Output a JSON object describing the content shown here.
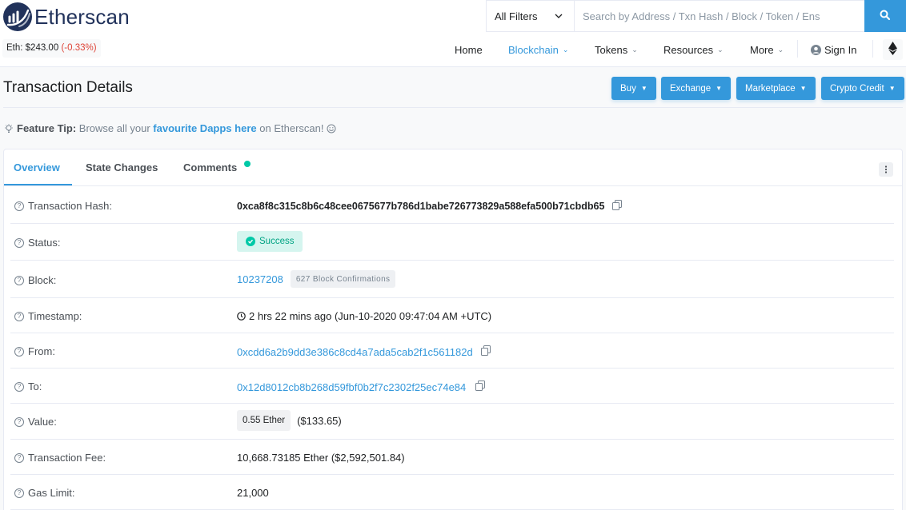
{
  "header": {
    "brand": "Etherscan",
    "eth_price_label": "Eth: $243.00",
    "eth_price_change": "(-0.33%)",
    "search": {
      "filter": "All Filters",
      "placeholder": "Search by Address / Txn Hash / Block / Token / Ens"
    },
    "nav": {
      "home": "Home",
      "blockchain": "Blockchain",
      "tokens": "Tokens",
      "resources": "Resources",
      "more": "More",
      "sign_in": "Sign In"
    }
  },
  "page": {
    "title": "Transaction Details",
    "buttons": {
      "buy": "Buy",
      "exchange": "Exchange",
      "marketplace": "Marketplace",
      "crypto_credit": "Crypto Credit"
    }
  },
  "tip": {
    "label": "Feature Tip:",
    "text_before": "Browse all your",
    "link": "favourite Dapps here",
    "text_after": "on Etherscan!"
  },
  "tabs": {
    "overview": "Overview",
    "state_changes": "State Changes",
    "comments": "Comments"
  },
  "details": {
    "hash": {
      "label": "Transaction Hash:",
      "value": "0xca8f8c315c8b6c48cee0675677b786d1babe726773829a588efa500b71cbdb65"
    },
    "status": {
      "label": "Status:",
      "value": "Success"
    },
    "block": {
      "label": "Block:",
      "value": "10237208",
      "confirmations": "627 Block Confirmations"
    },
    "timestamp": {
      "label": "Timestamp:",
      "value": "2 hrs 22 mins ago (Jun-10-2020 09:47:04 AM +UTC)"
    },
    "from": {
      "label": "From:",
      "value": "0xcdd6a2b9dd3e386c8cd4a7ada5cab2f1c561182d"
    },
    "to": {
      "label": "To:",
      "value": "0x12d8012cb8b268d59fbf0b2f7c2302f25ec74e84"
    },
    "value": {
      "label": "Value:",
      "ether": "0.55 Ether",
      "usd": "($133.65)"
    },
    "fee": {
      "label": "Transaction Fee:",
      "value": "10,668.73185 Ether ($2,592,501.84)"
    },
    "gas_limit": {
      "label": "Gas Limit:",
      "value": "21,000"
    }
  },
  "colors": {
    "accent": "#3498db",
    "brand": "#21325b",
    "success": "#00c9a7",
    "negative": "#de4437"
  }
}
